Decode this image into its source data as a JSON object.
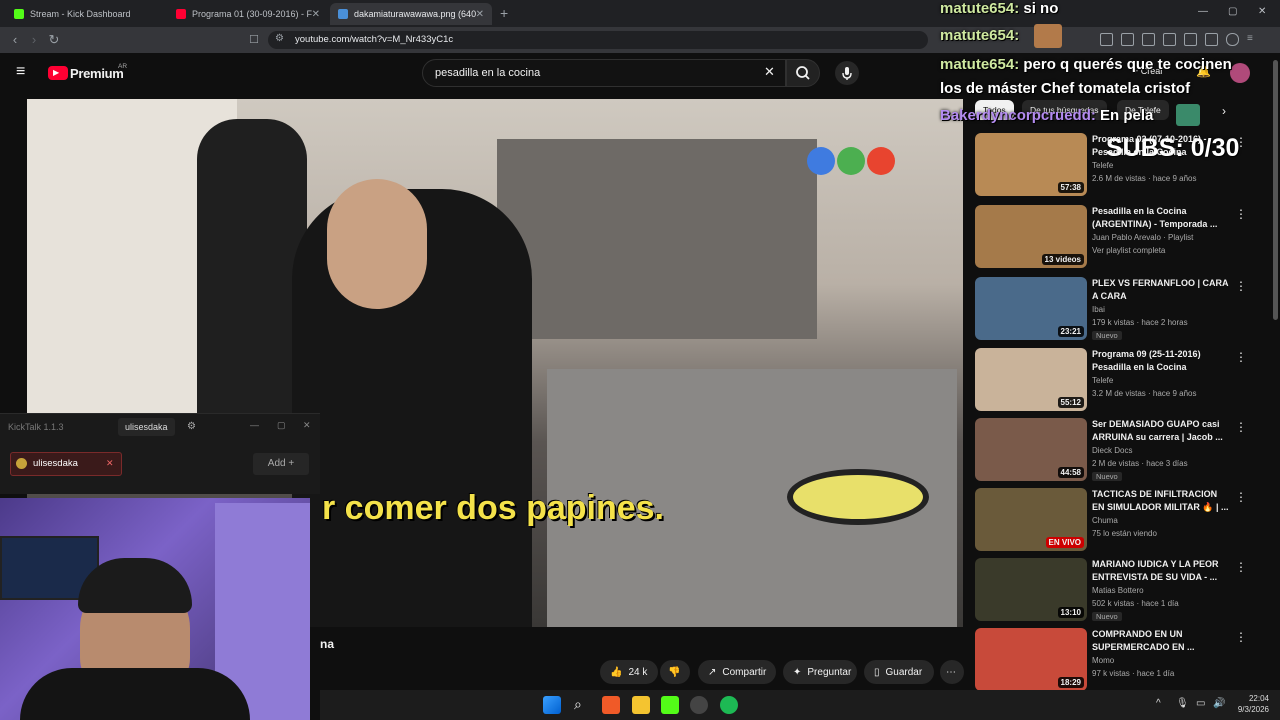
{
  "browser": {
    "tabs": [
      {
        "label": "Stream - Kick Dashboard",
        "icon": "kick-icon"
      },
      {
        "label": "Programa 01 (30-09-2016) - F",
        "icon": "youtube-icon"
      },
      {
        "label": "dakamiaturawawawa.png (640×",
        "icon": "image-icon"
      }
    ],
    "new_tab": "+",
    "url": "youtube.com/watch?v=M_Nr433yC1c",
    "window_controls": [
      "—",
      "▢",
      "✕"
    ]
  },
  "youtube": {
    "logo": "Premium",
    "country": "AR",
    "search_value": "pesadilla en la cocina",
    "create_label": "Crear",
    "chips": [
      "Todos",
      "De tus búsquedas",
      "De Telefe"
    ]
  },
  "video": {
    "subtitle": "r comer dos papines.",
    "below_title": "na",
    "actions": {
      "likes": "24 k",
      "share": "Compartir",
      "ask": "Preguntar",
      "save": "Guardar"
    }
  },
  "kicktalk": {
    "title": "KickTalk 1.1.3",
    "user": "ulisesdaka",
    "chip": "ulisesdaka",
    "add": "Add"
  },
  "overlay": {
    "subs": "SUBS: 0/30",
    "chat": [
      {
        "user": "matute654:",
        "text": "si no"
      },
      {
        "user": "matute654:",
        "text": ""
      },
      {
        "user": "matute654:",
        "text": "pero q querés que te cocinen"
      },
      {
        "user": "",
        "text": "los de máster Chef tomatela cristof"
      },
      {
        "user": "Bakerdyncorpcruedd:",
        "text": "En pela"
      }
    ]
  },
  "recommendations": [
    {
      "title": "Programa 02 (07-10-2016) - Pesadilla en la Cocina",
      "channel": "Telefe",
      "meta": "2.6 M de vistas · hace 9 años",
      "duration": "57:38",
      "badge": "",
      "thumb": "#b88a55"
    },
    {
      "title": "Pesadilla en la Cocina (ARGENTINA) - Temporada ...",
      "channel": "Juan Pablo Arevalo · Playlist",
      "meta": "Ver playlist completa",
      "duration": "13 videos",
      "badge": "",
      "thumb": "#a57a4a"
    },
    {
      "title": "PLEX VS FERNANFLOO | CARA A CARA",
      "channel": "Ibai",
      "meta": "179 k vistas · hace 2 horas",
      "duration": "23:21",
      "badge": "Nuevo",
      "thumb": "#4a6a8a"
    },
    {
      "title": "Programa 09 (25-11-2016) Pesadilla en la Cocina",
      "channel": "Telefe",
      "meta": "3.2 M de vistas · hace 9 años",
      "duration": "55:12",
      "badge": "",
      "thumb": "#c9b39a"
    },
    {
      "title": "Ser DEMASIADO GUAPO casi ARRUINA su carrera | Jacob ...",
      "channel": "Dieck Docs",
      "meta": "2 M de vistas · hace 3 días",
      "duration": "44:58",
      "badge": "Nuevo",
      "thumb": "#7a5a4a"
    },
    {
      "title": "TACTICAS DE INFILTRACION EN SIMULADOR MILITAR 🔥 | ...",
      "channel": "Chuma",
      "meta": "75 lo están viendo",
      "duration": "EN VIVO",
      "badge": "",
      "thumb": "#6a5a3a"
    },
    {
      "title": "MARIANO IUDICA Y LA PEOR ENTREVISTA DE SU VIDA - ...",
      "channel": "Matias Bottero",
      "meta": "502 k vistas · hace 1 día",
      "duration": "13:10",
      "badge": "Nuevo",
      "thumb": "#3a3a2a"
    },
    {
      "title": "COMPRANDO EN UN SUPERMERCADO EN ...",
      "channel": "Momo",
      "meta": "97 k vistas · hace 1 día",
      "duration": "18:29",
      "badge": "",
      "thumb": "#c84a3a"
    }
  ],
  "taskbar": {
    "time": "22:04",
    "date": "9/3/2026"
  }
}
